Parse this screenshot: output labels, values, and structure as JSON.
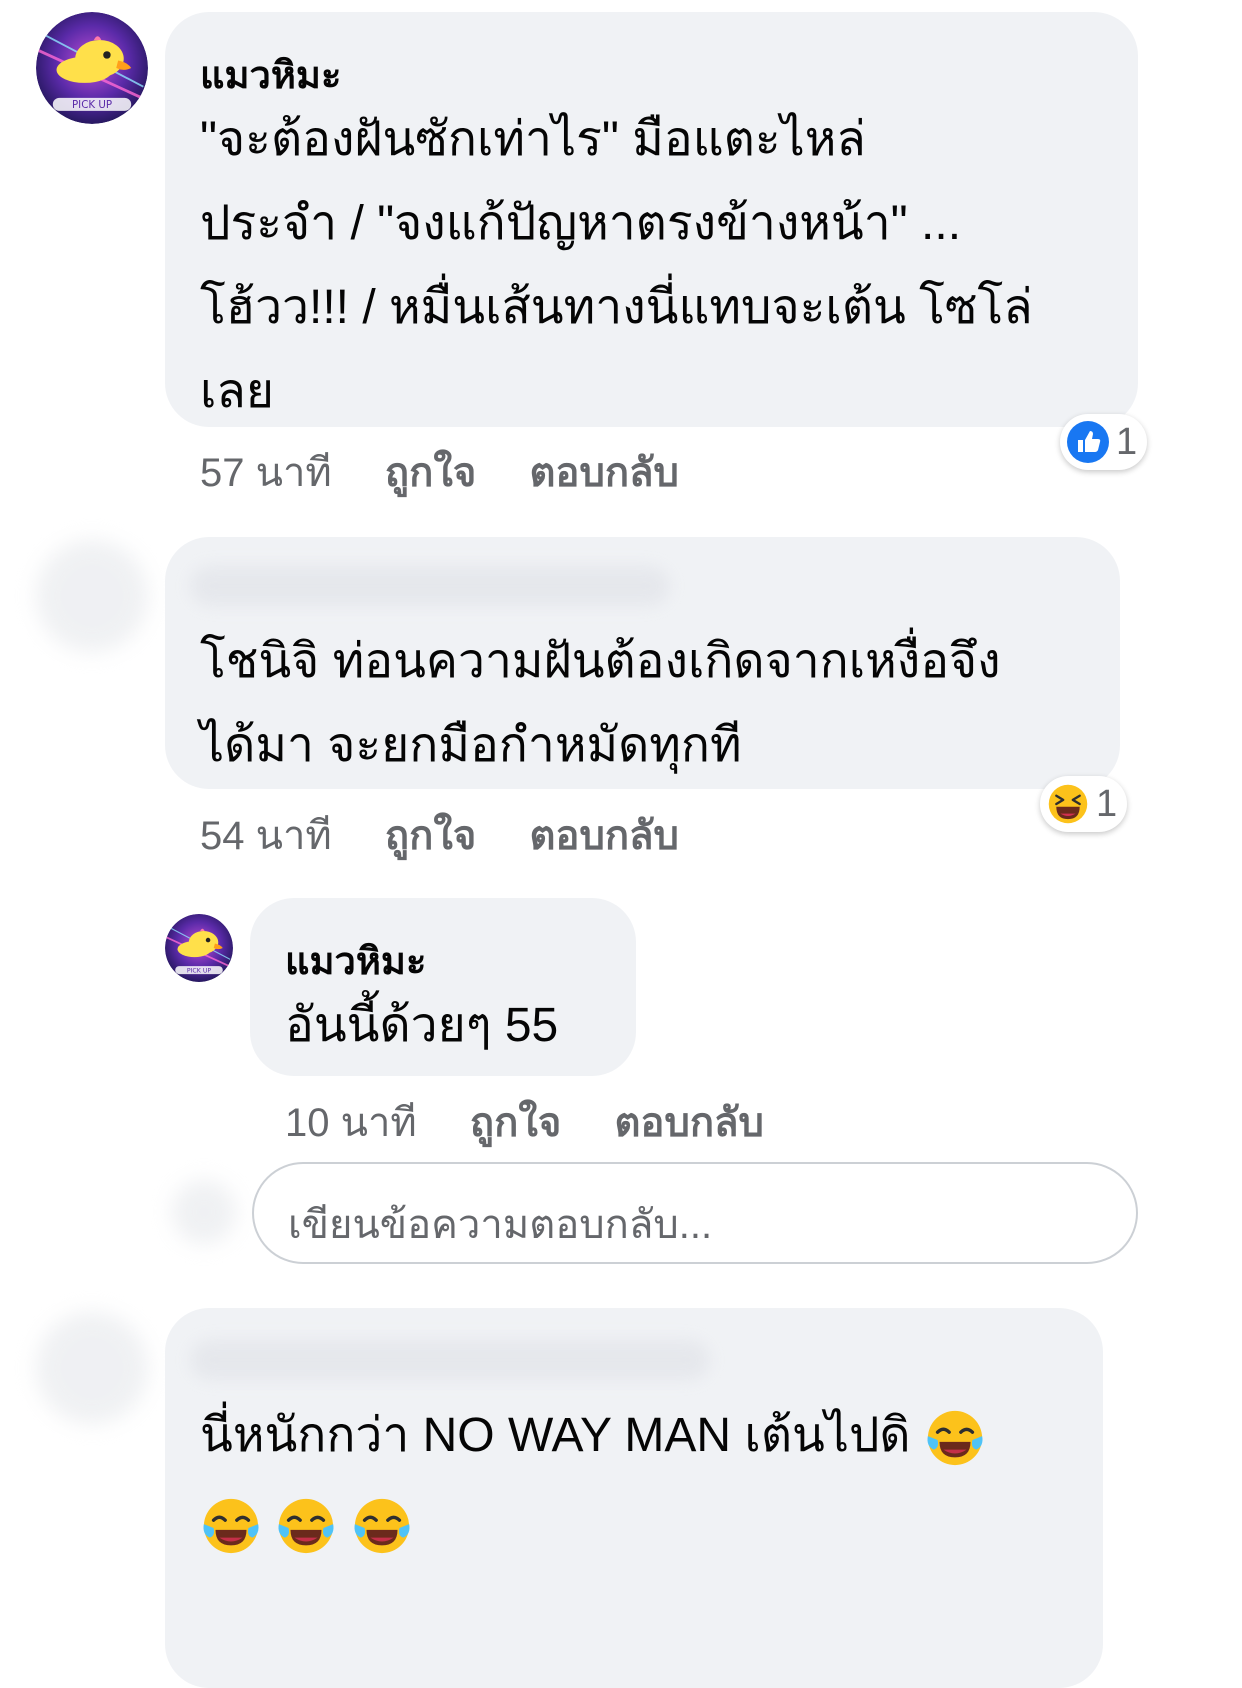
{
  "comments": [
    {
      "author": "แมวหิมะ",
      "lines": [
        "\"จะต้องฝันซักเท่าไร\" มือแตะไหล่",
        "ประจำ / \"จงแก้ปัญหาตรงข้างหน้า\" ...",
        "โฮ้วว!!! / หมื่นเส้นทางนี่แทบจะเต้น โซโล่",
        "เลย"
      ],
      "time": "57 นาที",
      "like": "ถูกใจ",
      "reply": "ตอบกลับ",
      "reaction_icon": "like-icon",
      "reaction_count": "1"
    },
    {
      "author": "",
      "lines": [
        "โชนิจิ ท่อนความฝันต้องเกิดจากเหงื่อจึง",
        "ได้มา จะยกมือกำหมัดทุกที"
      ],
      "time": "54 นาที",
      "like": "ถูกใจ",
      "reply": "ตอบกลับ",
      "reaction_icon": "laughing-emoji-icon",
      "reaction_count": "1"
    },
    {
      "author": "แมวหิมะ",
      "lines": [
        "อันนี้ด้วยๆ 55"
      ],
      "time": "10 นาที",
      "like": "ถูกใจ",
      "reply": "ตอบกลับ"
    },
    {
      "author": "",
      "lines": [
        "นี่หนักกว่า NO WAY MAN เต้นไปดิ"
      ],
      "emoji_icon": "tears-of-joy-emoji-icon"
    }
  ],
  "reply_input": {
    "placeholder": "เขียนข้อความตอบกลับ..."
  },
  "colors": {
    "bubble": "#f0f2f5",
    "meta_text": "#65676b",
    "like_blue": "#1877f2",
    "emoji_yellow": "#fcc21b"
  }
}
